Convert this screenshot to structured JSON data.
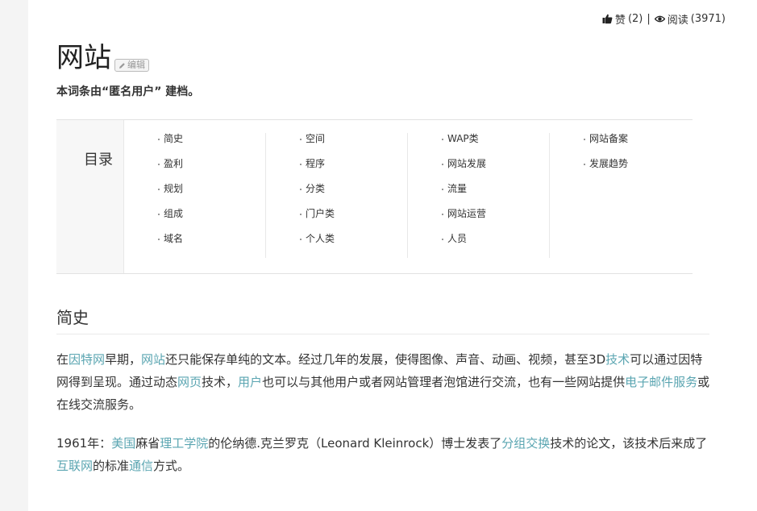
{
  "stats": {
    "like_label": "赞",
    "like_count": "(2)",
    "separator": "|",
    "read_label": "阅读",
    "read_count": "(3971)"
  },
  "header": {
    "title": "网站",
    "edit_label": "编辑",
    "creator": "本词条由“匿名用户” 建档。"
  },
  "toc": {
    "label": "目录",
    "columns": [
      [
        "简史",
        "盈利",
        "规划",
        "组成",
        "域名"
      ],
      [
        "空间",
        "程序",
        "分类",
        "门户类",
        "个人类"
      ],
      [
        "WAP类",
        "网站发展",
        "流量",
        "网站运营",
        "人员"
      ],
      [
        "网站备案",
        "发展趋势"
      ]
    ]
  },
  "section": {
    "heading": "简史",
    "p1": [
      {
        "t": "在",
        "link": false
      },
      {
        "t": "因特网",
        "link": true
      },
      {
        "t": "早期，",
        "link": false
      },
      {
        "t": "网站",
        "link": true
      },
      {
        "t": "还只能保存单纯的文本。经过几年的发展，使得图像、声音、动画、视频，甚至3D",
        "link": false
      },
      {
        "t": "技术",
        "link": true
      },
      {
        "t": "可以通过因特网得到呈现。通过动态",
        "link": false
      },
      {
        "t": "网页",
        "link": true
      },
      {
        "t": "技术，",
        "link": false
      },
      {
        "t": "用户",
        "link": true
      },
      {
        "t": "也可以与其他用户或者网站管理者泡馆进行交流，也有一些网站提供",
        "link": false
      },
      {
        "t": "电子邮件服务",
        "link": true
      },
      {
        "t": "或在线交流服务。",
        "link": false
      }
    ],
    "p2": [
      {
        "t": "1961年：",
        "link": false
      },
      {
        "t": "美国",
        "link": true
      },
      {
        "t": "麻省",
        "link": false
      },
      {
        "t": "理工学院",
        "link": true
      },
      {
        "t": "的伦纳德.克兰罗克（Leonard Kleinrock）博士发表了",
        "link": false
      },
      {
        "t": "分组交换",
        "link": true
      },
      {
        "t": "技术的论文，该技术后来成了",
        "link": false
      },
      {
        "t": "互联网",
        "link": true
      },
      {
        "t": "的标准",
        "link": false
      },
      {
        "t": "通信",
        "link": true
      },
      {
        "t": "方式。",
        "link": false
      }
    ]
  },
  "colors": {
    "link": "#5aa5b1",
    "text": "#333333",
    "sidebar_bg": "#f4f4f4"
  },
  "icons": {
    "like": "thumbs-up-icon",
    "read": "eye-icon",
    "edit": "pencil-icon"
  }
}
